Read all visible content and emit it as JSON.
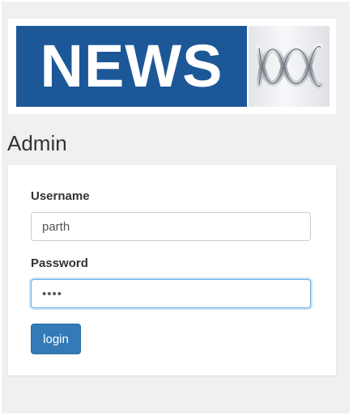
{
  "logo": {
    "news_text": "NEWS",
    "brand_icon": "abc-lissajous-icon",
    "news_bg": "#1c5798"
  },
  "page": {
    "title": "Admin"
  },
  "form": {
    "username_label": "Username",
    "username_value": "parth",
    "password_label": "Password",
    "password_value": "••••",
    "login_label": "login"
  },
  "colors": {
    "primary": "#337ab7",
    "focus": "#66afe9"
  }
}
